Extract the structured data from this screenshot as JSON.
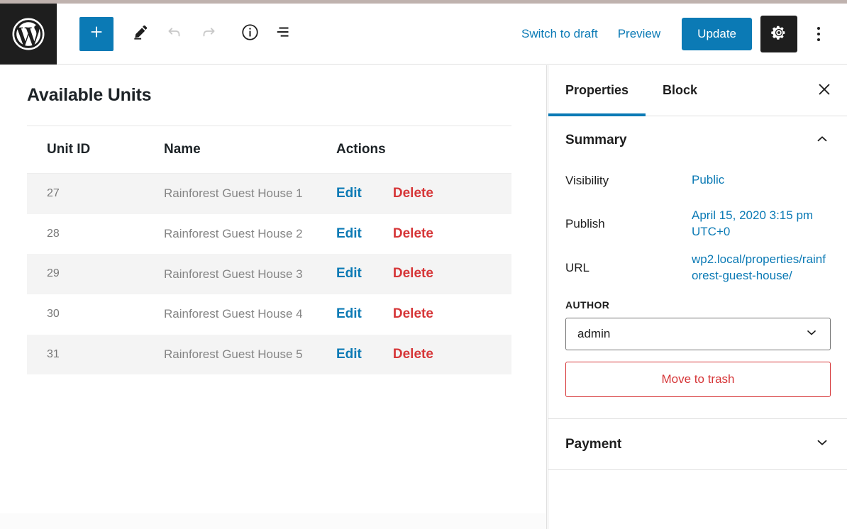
{
  "toolbar": {
    "logo_icon": "wordpress-logo-icon",
    "add_icon": "plus-icon",
    "edit_icon": "pencil-icon",
    "undo_icon": "undo-arrow-icon",
    "redo_icon": "redo-arrow-icon",
    "info_icon": "info-circle-icon",
    "list_view_icon": "list-view-icon",
    "switch_to_draft_label": "Switch to draft",
    "preview_label": "Preview",
    "update_label": "Update",
    "settings_icon": "gear-icon",
    "more_icon": "kebab-menu-icon",
    "accent_color": "#0b7ab5",
    "dark_color": "#1e1e1e"
  },
  "editor": {
    "title": "Available Units",
    "table": {
      "columns": [
        "Unit ID",
        "Name",
        "Actions"
      ],
      "rows": [
        {
          "id": "27",
          "name": "Rainforest Guest House 1",
          "edit": "Edit",
          "delete": "Delete"
        },
        {
          "id": "28",
          "name": "Rainforest Guest House 2",
          "edit": "Edit",
          "delete": "Delete"
        },
        {
          "id": "29",
          "name": "Rainforest Guest House 3",
          "edit": "Edit",
          "delete": "Delete"
        },
        {
          "id": "30",
          "name": "Rainforest Guest House 4",
          "edit": "Edit",
          "delete": "Delete"
        },
        {
          "id": "31",
          "name": "Rainforest Guest House 5",
          "edit": "Edit",
          "delete": "Delete"
        }
      ],
      "edit_color": "#0b7ab5",
      "delete_color": "#d63638"
    }
  },
  "sidebar": {
    "tabs": [
      {
        "label": "Properties",
        "active": true
      },
      {
        "label": "Block",
        "active": false
      }
    ],
    "close_icon": "close-x-icon",
    "summary": {
      "heading": "Summary",
      "toggle_icon": "chevron-up-icon",
      "visibility_label": "Visibility",
      "visibility_value": "Public",
      "publish_label": "Publish",
      "publish_value": "April 15, 2020 3:15 pm UTC+0",
      "url_label": "URL",
      "url_value": "wp2.local/properties/rainforest-guest-house/",
      "author_label": "AUTHOR",
      "author_value": "admin",
      "author_chevron_icon": "chevron-down-icon",
      "trash_label": "Move to trash",
      "trash_color": "#d63638"
    },
    "panels": [
      {
        "label": "Payment",
        "toggle_icon": "chevron-down-icon"
      }
    ]
  }
}
